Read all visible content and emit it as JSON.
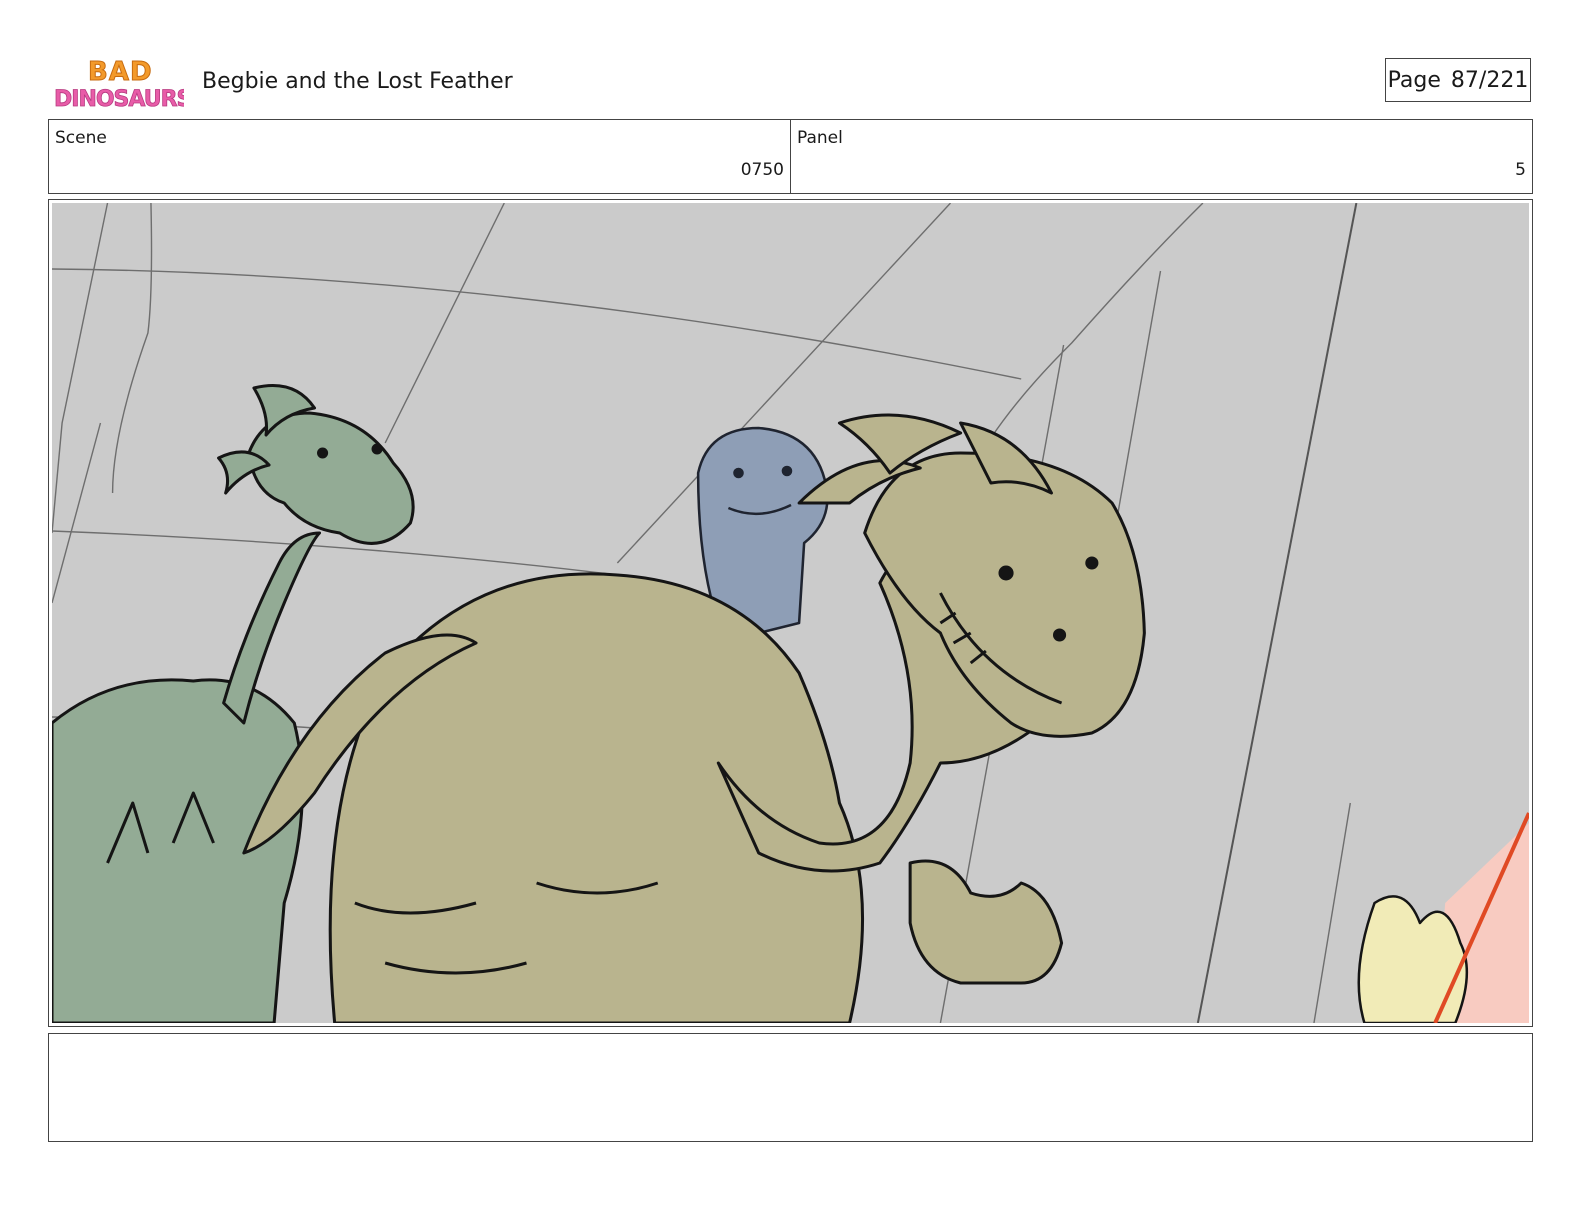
{
  "header": {
    "logo_text": "BAD DINOSAURS",
    "title": "Begbie and the Lost Feather",
    "page_label": "Page",
    "page_value": "87/221"
  },
  "info": {
    "scene_label": "Scene",
    "scene_value": "0750",
    "panel_label": "Panel",
    "panel_value": "5"
  },
  "panel_art": {
    "background_color": "#cbcbcb",
    "colors": {
      "green_dino": "#93ab95",
      "khaki_dino": "#b9b48e",
      "blue_dino": "#8e9eb6",
      "feather_yellow": "#f1ebb7",
      "pink_edge": "#f8cbc1",
      "red_line": "#e04a24"
    }
  },
  "notes": {
    "text": ""
  }
}
